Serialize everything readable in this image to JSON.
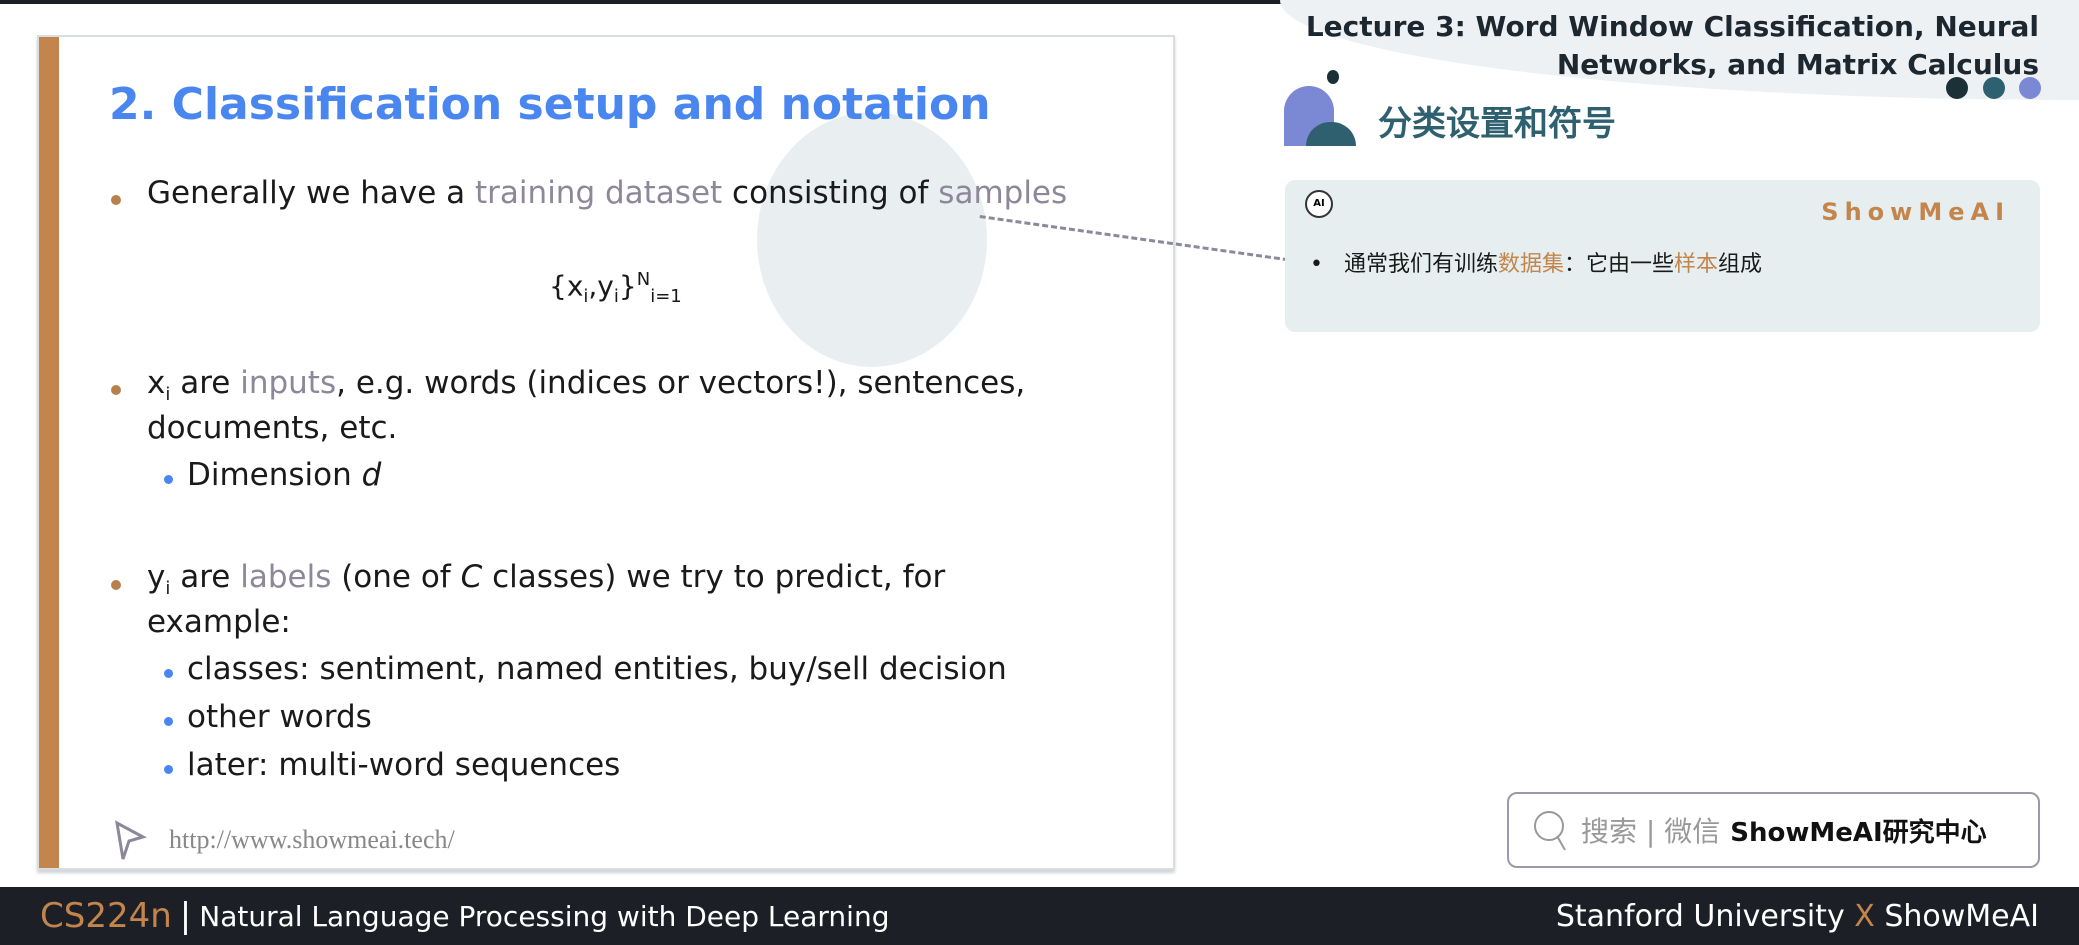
{
  "header": {
    "line1": "Lecture 3: Word Window Classification, Neural",
    "line2": "Networks, and Matrix Calculus"
  },
  "slide": {
    "title": "2. Classification setup and notation",
    "b1": {
      "pre": "Generally we have a ",
      "hl1": "training dataset",
      "mid": " consisting of ",
      "hl2": "samples"
    },
    "formula": {
      "open": "{x",
      "i1": "i",
      "comma": ",y",
      "i2": "i",
      "close": "}",
      "sup": "N",
      "sub": "i=1"
    },
    "b2": {
      "x": "x",
      "i": "i",
      "pre": " are ",
      "hl": "inputs",
      "post": ", e.g. words (indices or vectors!), sentences,",
      "cont": "documents, etc."
    },
    "b2s1": {
      "pre": "Dimension ",
      "em": "d"
    },
    "b3": {
      "y": "y",
      "i": "i",
      "pre": " are ",
      "hl": "labels",
      "post1": " (one of ",
      "em": "C",
      "post2": " classes) we try to predict, for",
      "cont": "example:"
    },
    "subs": [
      "classes: sentiment, named entities, buy/sell decision",
      "other words",
      "later: multi-word sequences"
    ],
    "url": "http://www.showmeai.tech/"
  },
  "notes": {
    "title": "分类设置和符号",
    "brand": "ShowMeAI",
    "ai_icon": "AI",
    "text": {
      "a": "通常我们有训练",
      "b": "数据集",
      "c": "：它由一些",
      "d": "样本",
      "e": "组成"
    }
  },
  "search": {
    "label": "搜索 | 微信",
    "brand": "ShowMeAI研究中心"
  },
  "footer": {
    "course": "CS224n",
    "sep": "|",
    "subtitle": "Natural Language Processing with Deep Learning",
    "left": "Stanford University ",
    "x": "X",
    "right": " ShowMeAI"
  },
  "colors": {
    "accent": "#4a86f0",
    "orange": "#c4854c",
    "teal": "#2f6070"
  }
}
